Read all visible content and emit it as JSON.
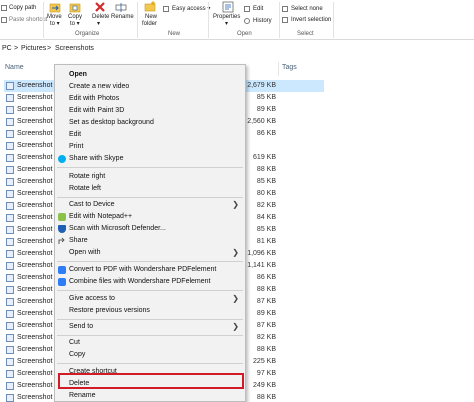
{
  "ribbon": {
    "clipboard": {
      "copy_path": "Copy path",
      "paste_shortcut": "Paste shortcut",
      "group_label": ""
    },
    "organize": {
      "move_to": "Move",
      "move_to_2": "to ▾",
      "copy_to": "Copy",
      "copy_to_2": "to ▾",
      "delete": "Delete",
      "delete_2": "▾",
      "rename": "Rename",
      "group_label": "Organize"
    },
    "new": {
      "new_folder": "New",
      "new_folder_2": "folder",
      "easy_access": "Easy access ▾",
      "group_label": "New"
    },
    "open": {
      "properties": "Properties",
      "properties_2": "▾",
      "edit": "Edit",
      "history": "History",
      "group_label": "Open"
    },
    "select": {
      "select_none": "Select none",
      "invert_selection": "Invert selection",
      "group_label": "Select"
    }
  },
  "address": {
    "pc": "PC",
    "sep1": ">",
    "pictures": "Pictures",
    "sep2": ">",
    "screenshots": "Screenshots"
  },
  "columns": {
    "name": "Name",
    "tags": "Tags"
  },
  "files": [
    {
      "name": "Screenshot",
      "size": "2,679 KB",
      "selected": true
    },
    {
      "name": "Screenshot",
      "size": "85 KB"
    },
    {
      "name": "Screenshot",
      "size": "89 KB"
    },
    {
      "name": "Screenshot",
      "size": "2,560 KB"
    },
    {
      "name": "Screenshot",
      "size": "86 KB"
    },
    {
      "name": "Screenshot",
      "size": "",
      "hidden": true
    },
    {
      "name": "Screenshot",
      "size": "619 KB"
    },
    {
      "name": "Screenshot",
      "size": "88 KB"
    },
    {
      "name": "Screenshot",
      "size": "85 KB"
    },
    {
      "name": "Screenshot",
      "size": "80 KB"
    },
    {
      "name": "Screenshot",
      "size": "82 KB"
    },
    {
      "name": "Screenshot",
      "size": "84 KB"
    },
    {
      "name": "Screenshot",
      "size": "85 KB"
    },
    {
      "name": "Screenshot",
      "size": "81 KB"
    },
    {
      "name": "Screenshot",
      "size": "1,096 KB"
    },
    {
      "name": "Screenshot",
      "size": "1,141 KB"
    },
    {
      "name": "Screenshot",
      "size": "86 KB"
    },
    {
      "name": "Screenshot",
      "size": "88 KB"
    },
    {
      "name": "Screenshot",
      "size": "87 KB"
    },
    {
      "name": "Screenshot",
      "size": "89 KB"
    },
    {
      "name": "Screenshot",
      "size": "87 KB"
    },
    {
      "name": "Screenshot",
      "size": "82 KB"
    },
    {
      "name": "Screenshot",
      "size": "88 KB"
    },
    {
      "name": "Screenshot",
      "size": "225 KB"
    },
    {
      "name": "Screenshot",
      "size": "97 KB"
    },
    {
      "name": "Screenshot",
      "size": "249 KB"
    },
    {
      "name": "Screenshot",
      "size": "88 KB"
    }
  ],
  "context_menu": {
    "open": "Open",
    "create_video": "Create a new video",
    "edit_photos": "Edit with Photos",
    "edit_paint3d": "Edit with Paint 3D",
    "set_background": "Set as desktop background",
    "edit": "Edit",
    "print": "Print",
    "share_skype": "Share with Skype",
    "rotate_right": "Rotate right",
    "rotate_left": "Rotate left",
    "cast_device": "Cast to Device",
    "edit_notepad": "Edit with Notepad++",
    "scan_defender": "Scan with Microsoft Defender...",
    "share": "Share",
    "open_with": "Open with",
    "convert_pdf": "Convert to PDF with Wondershare PDFelement",
    "combine_pdf": "Combine files with Wondershare PDFelement",
    "give_access": "Give access to",
    "restore_versions": "Restore previous versions",
    "send_to": "Send to",
    "cut": "Cut",
    "copy": "Copy",
    "create_shortcut": "Create shortcut",
    "delete": "Delete",
    "rename": "Rename",
    "arrow": "❯"
  },
  "colors": {
    "accent": "#0078d7",
    "selected_row": "#cce8ff",
    "highlight_border": "#d01c28",
    "menu_bg": "#f2f2f2"
  }
}
